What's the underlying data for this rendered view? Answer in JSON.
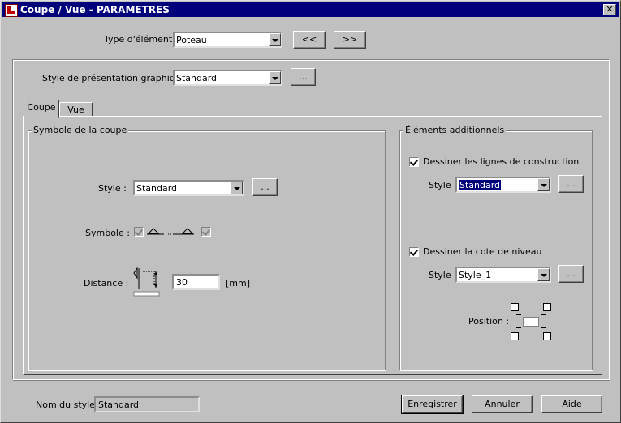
{
  "window": {
    "title": "Coupe / Vue - PARAMETRES",
    "close_label": "✕"
  },
  "element_type": {
    "label": "Type d'élément :",
    "value": "Poteau",
    "prev_label": "<<",
    "next_label": ">>"
  },
  "presentation": {
    "label": "Style de présentation graphique :",
    "value": "Standard",
    "browse_label": "..."
  },
  "tabs": [
    {
      "label": "Coupe",
      "active": true
    },
    {
      "label": "Vue",
      "active": false
    }
  ],
  "coupe": {
    "group_title": "Symbole de la coupe",
    "style_label": "Style :",
    "style_value": "Standard",
    "style_browse": "...",
    "symbole_label": "Symbole :",
    "distance_label": "Distance :",
    "distance_value": "30",
    "distance_unit": "[mm]"
  },
  "additional": {
    "group_title": "Éléments additionnels",
    "construction_label": "Dessiner les lignes de construction",
    "construction_checked": true,
    "construction_style_label": "Style :",
    "construction_style_value": "Standard",
    "construction_browse": "...",
    "level_label": "Dessiner la cote de niveau",
    "level_checked": true,
    "level_style_label": "Style :",
    "level_style_value": "Style_1",
    "level_browse": "...",
    "position_label": "Position :"
  },
  "footer": {
    "style_name_label": "Nom du style :",
    "style_name_value": "Standard",
    "save_label": "Enregistrer",
    "cancel_label": "Annuler",
    "help_label": "Aide"
  },
  "colors": {
    "titlebar": "#00007b",
    "selection": "#00007b"
  }
}
